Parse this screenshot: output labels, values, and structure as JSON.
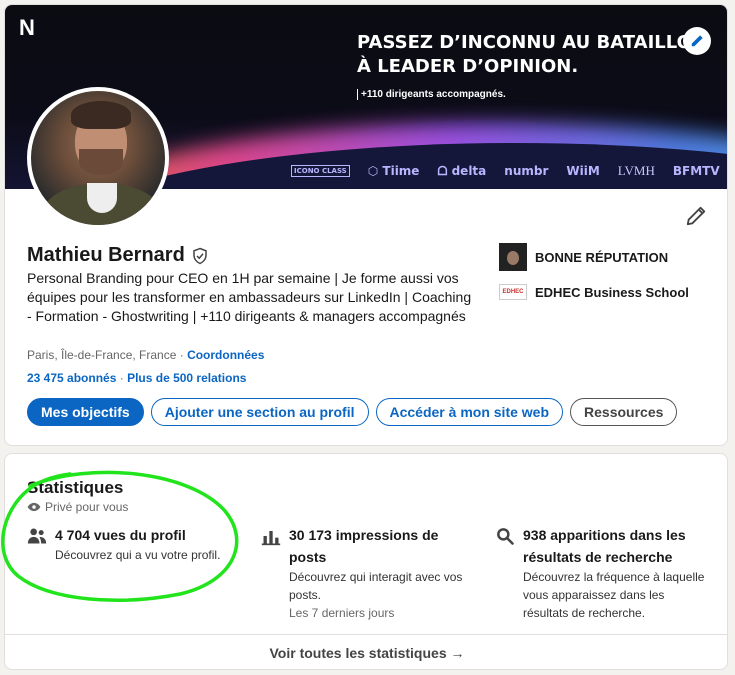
{
  "banner": {
    "logo": "N",
    "headline_line1": "PASSEZ D’INCONNU AU BATAILLON",
    "headline_line2": "À LEADER D’OPINION.",
    "subline": "+110 dirigeants accompagnés.",
    "brands": [
      "ICONO CLASS",
      "⬡ Tiime",
      "ᗝ delta",
      "numbr",
      "WiiM",
      "LVMH",
      "BFMTV"
    ]
  },
  "profile": {
    "name": "Mathieu Bernard",
    "headline": "Personal Branding pour CEO en 1H par semaine | Je forme aussi vos équipes pour les transformer en ambassadeurs sur LinkedIn | Coaching - Formation - Ghostwriting | +110 dirigeants & managers accompagnés",
    "location": "Paris, Île-de-France, France",
    "location_sep": " · ",
    "contact_link": "Coordonnées",
    "followers": "23 475 abonnés",
    "counts_sep": " · ",
    "connections": "Plus de 500 relations",
    "side": {
      "company": "BONNE RÉPUTATION",
      "school": "EDHEC Business School",
      "school_logo_text": "EDHEC"
    },
    "buttons": {
      "objectives": "Mes objectifs",
      "add_section": "Ajouter une section au profil",
      "website": "Accéder à mon site web",
      "resources": "Ressources"
    }
  },
  "stats": {
    "title": "Statistiques",
    "private": "Privé pour vous",
    "items": [
      {
        "value": "4 704 vues du profil",
        "desc": "Découvrez qui a vu votre profil.",
        "note": ""
      },
      {
        "value": "30 173 impressions de posts",
        "desc": "Découvrez qui interagit avec vos posts.",
        "note": "Les 7 derniers jours"
      },
      {
        "value": "938 apparitions dans les résultats de recherche",
        "desc": "Découvrez la fréquence à laquelle vous apparaissez dans les résultats de recherche.",
        "note": ""
      }
    ],
    "footer": "Voir toutes les statistiques →"
  },
  "colors": {
    "accent": "#0a66c2",
    "highlight": "#22e41c"
  },
  "icons": [
    "pencil-icon",
    "verified-shield-icon",
    "eye-icon",
    "people-icon",
    "bar-chart-icon",
    "search-icon"
  ]
}
